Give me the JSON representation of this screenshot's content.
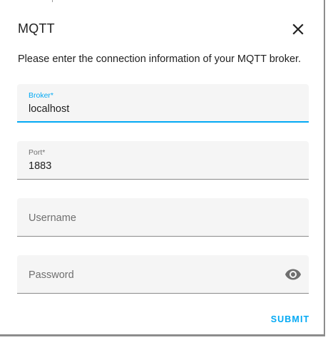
{
  "dialog": {
    "title": "MQTT",
    "description": "Please enter the connection information of your MQTT broker."
  },
  "fields": {
    "broker": {
      "label": "Broker*",
      "value": "localhost"
    },
    "port": {
      "label": "Port*",
      "value": "1883"
    },
    "username": {
      "label": "Username",
      "value": ""
    },
    "password": {
      "label": "Password",
      "value": ""
    }
  },
  "icons": {
    "close": "close-icon",
    "visibility": "eye-icon"
  },
  "actions": {
    "submit_label": "SUBMIT"
  },
  "colors": {
    "accent": "#03a9f4",
    "field_background": "#f5f5f5",
    "text": "#212121",
    "label": "#6f6f6f"
  }
}
